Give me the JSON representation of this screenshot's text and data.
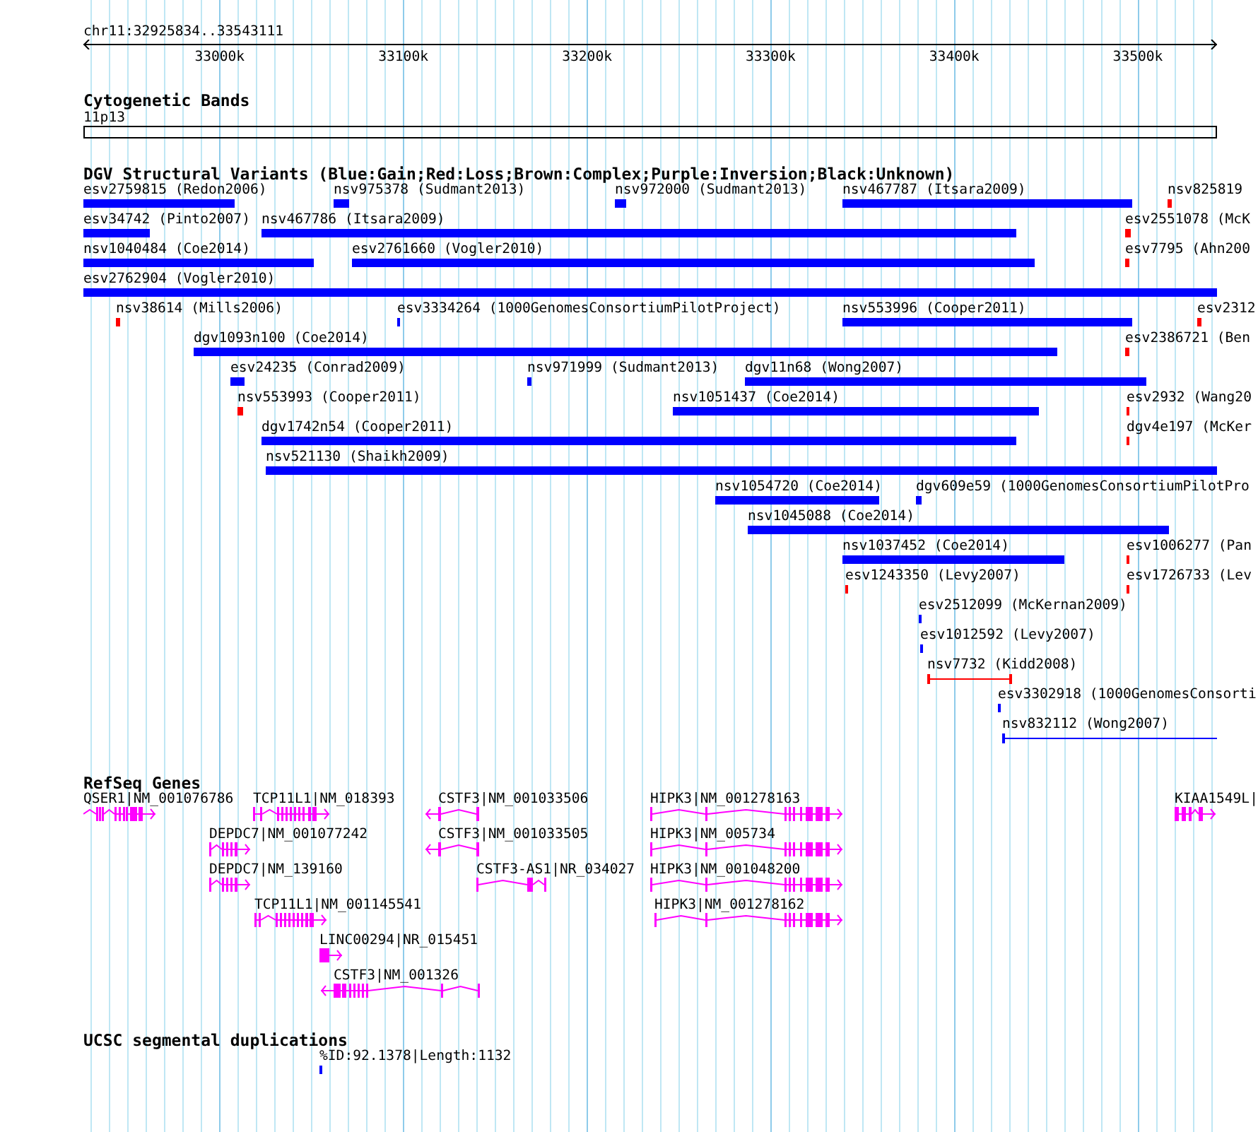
{
  "ruler": {
    "region": "chr11:32925834..33543111",
    "ticks": [
      {
        "label": "33000k"
      },
      {
        "label": "33100k"
      },
      {
        "label": "33200k"
      },
      {
        "label": "33300k"
      },
      {
        "label": "33400k"
      },
      {
        "label": "33500k"
      }
    ]
  },
  "tracks": [
    {
      "kind": "cytoband",
      "title": "Cytogenetic Bands",
      "bands": [
        {
          "label": "11p13"
        }
      ]
    },
    {
      "kind": "features",
      "title": "DGV Structural Variants (Blue:Gain;Red:Loss;Brown:Complex;Purple:Inversion;Black:Unknown)",
      "lanes": [
        {
          "features": [
            {
              "label": "esv2759815 (Redon2006)",
              "color": "#0000ff",
              "kind": "bar"
            },
            {
              "label": "nsv975378 (Sudmant2013)",
              "color": "#0000ff",
              "kind": "bar"
            },
            {
              "label": "nsv972000 (Sudmant2013)",
              "color": "#0000ff",
              "kind": "bar"
            },
            {
              "label": "nsv467787 (Itsara2009)",
              "color": "#0000ff",
              "kind": "bar"
            },
            {
              "label": "nsv825819",
              "color": "#ff0000",
              "kind": "bar"
            }
          ]
        },
        {
          "features": [
            {
              "label": "esv34742 (Pinto2007)",
              "color": "#0000ff",
              "kind": "bar"
            },
            {
              "label": "nsv467786 (Itsara2009)",
              "color": "#0000ff",
              "kind": "bar"
            },
            {
              "label": "esv2551078 (McK",
              "color": "#ff0000",
              "kind": "bar"
            }
          ]
        },
        {
          "features": [
            {
              "label": "nsv1040484 (Coe2014)",
              "color": "#0000ff",
              "kind": "bar"
            },
            {
              "label": "esv2761660 (Vogler2010)",
              "color": "#0000ff",
              "kind": "bar"
            },
            {
              "label": "esv7795 (Ahn200",
              "color": "#ff0000",
              "kind": "bar"
            }
          ]
        },
        {
          "features": [
            {
              "label": "esv2762904 (Vogler2010)",
              "color": "#0000ff",
              "kind": "bar"
            }
          ]
        },
        {
          "features": [
            {
              "label": "nsv38614 (Mills2006)",
              "color": "#ff0000",
              "kind": "bar"
            },
            {
              "label": "esv3334264 (1000GenomesConsortiumPilotProject)",
              "color": "#0000ff",
              "kind": "bar"
            },
            {
              "label": "nsv553996 (Cooper2011)",
              "color": "#0000ff",
              "kind": "bar"
            },
            {
              "label": "esv2312",
              "color": "#ff0000",
              "kind": "bar"
            }
          ]
        },
        {
          "features": [
            {
              "label": "dgv1093n100 (Coe2014)",
              "color": "#0000ff",
              "kind": "bar"
            },
            {
              "label": "esv2386721 (Ben",
              "color": "#ff0000",
              "kind": "bar"
            }
          ]
        },
        {
          "features": [
            {
              "label": "esv24235 (Conrad2009)",
              "color": "#0000ff",
              "kind": "bar"
            },
            {
              "label": "nsv971999 (Sudmant2013)",
              "color": "#0000ff",
              "kind": "bar"
            },
            {
              "label": "dgv11n68 (Wong2007)",
              "color": "#0000ff",
              "kind": "bar"
            }
          ]
        },
        {
          "features": [
            {
              "label": "nsv553993 (Cooper2011)",
              "color": "#ff0000",
              "kind": "bar"
            },
            {
              "label": "nsv1051437 (Coe2014)",
              "color": "#0000ff",
              "kind": "bar"
            },
            {
              "label": "esv2932 (Wang20",
              "color": "#ff0000",
              "kind": "bar"
            }
          ]
        },
        {
          "features": [
            {
              "label": "dgv1742n54 (Cooper2011)",
              "color": "#0000ff",
              "kind": "bar"
            },
            {
              "label": "dgv4e197 (McKer",
              "color": "#ff0000",
              "kind": "bar"
            }
          ]
        },
        {
          "features": [
            {
              "label": "nsv521130 (Shaikh2009)",
              "color": "#0000ff",
              "kind": "bar"
            }
          ]
        },
        {
          "features": [
            {
              "label": "nsv1054720 (Coe2014)",
              "color": "#0000ff",
              "kind": "bar"
            },
            {
              "label": "dgv609e59 (1000GenomesConsortiumPilotPro",
              "color": "#0000ff",
              "kind": "bar"
            }
          ]
        },
        {
          "features": [
            {
              "label": "nsv1045088 (Coe2014)",
              "color": "#0000ff",
              "kind": "bar"
            }
          ]
        },
        {
          "features": [
            {
              "label": "nsv1037452 (Coe2014)",
              "color": "#0000ff",
              "kind": "bar"
            },
            {
              "label": "esv1006277 (Pan",
              "color": "#ff0000",
              "kind": "bar"
            }
          ]
        },
        {
          "features": [
            {
              "label": "esv1243350 (Levy2007)",
              "color": "#ff0000",
              "kind": "bar"
            },
            {
              "label": "esv1726733 (Lev",
              "color": "#ff0000",
              "kind": "bar"
            }
          ]
        },
        {
          "features": [
            {
              "label": "esv2512099 (McKernan2009)",
              "color": "#0000ff",
              "kind": "bar"
            }
          ]
        },
        {
          "features": [
            {
              "label": "esv1012592 (Levy2007)",
              "color": "#0000ff",
              "kind": "bar"
            }
          ]
        },
        {
          "features": [
            {
              "label": "nsv7732 (Kidd2008)",
              "color": "#ff0000",
              "kind": "linked"
            }
          ]
        },
        {
          "features": [
            {
              "label": "esv3302918 (1000GenomesConsorti",
              "color": "#0000ff",
              "kind": "bar"
            }
          ]
        },
        {
          "features": [
            {
              "label": "nsv832112 (Wong2007)",
              "color": "#0000ff",
              "kind": "linked"
            }
          ]
        }
      ]
    },
    {
      "kind": "genes",
      "title": "RefSeq Genes",
      "lanes": [
        {
          "genes": [
            {
              "label": "QSER1|NM_001076786",
              "kind": "forward"
            },
            {
              "label": "TCP11L1|NM_018393",
              "kind": "forward"
            },
            {
              "label": "CSTF3|NM_001033506",
              "kind": "reverse"
            },
            {
              "label": "HIPK3|NM_001278163",
              "kind": "forward"
            },
            {
              "label": "KIAA1549L|",
              "kind": "forward"
            }
          ]
        },
        {
          "genes": [
            {
              "label": "DEPDC7|NM_001077242",
              "kind": "forward"
            },
            {
              "label": "CSTF3|NM_001033505",
              "kind": "reverse"
            },
            {
              "label": "HIPK3|NM_005734",
              "kind": "forward"
            }
          ]
        },
        {
          "genes": [
            {
              "label": "DEPDC7|NM_139160",
              "kind": "forward"
            },
            {
              "label": "CSTF3-AS1|NR_034027",
              "kind": "plain"
            },
            {
              "label": "HIPK3|NM_001048200",
              "kind": "forward"
            }
          ]
        },
        {
          "genes": [
            {
              "label": "TCP11L1|NM_001145541",
              "kind": "forward"
            },
            {
              "label": "HIPK3|NM_001278162",
              "kind": "forward"
            }
          ]
        },
        {
          "genes": [
            {
              "label": "LINC00294|NR_015451",
              "kind": "forward"
            }
          ]
        },
        {
          "genes": [
            {
              "label": "CSTF3|NM_001326",
              "kind": "reverse"
            }
          ]
        }
      ]
    },
    {
      "kind": "features",
      "title": "UCSC segmental duplications",
      "lanes": [
        {
          "features": [
            {
              "label": "%ID:92.1378|Length:1132",
              "color": "#0000ff",
              "kind": "bar"
            }
          ]
        }
      ]
    }
  ]
}
